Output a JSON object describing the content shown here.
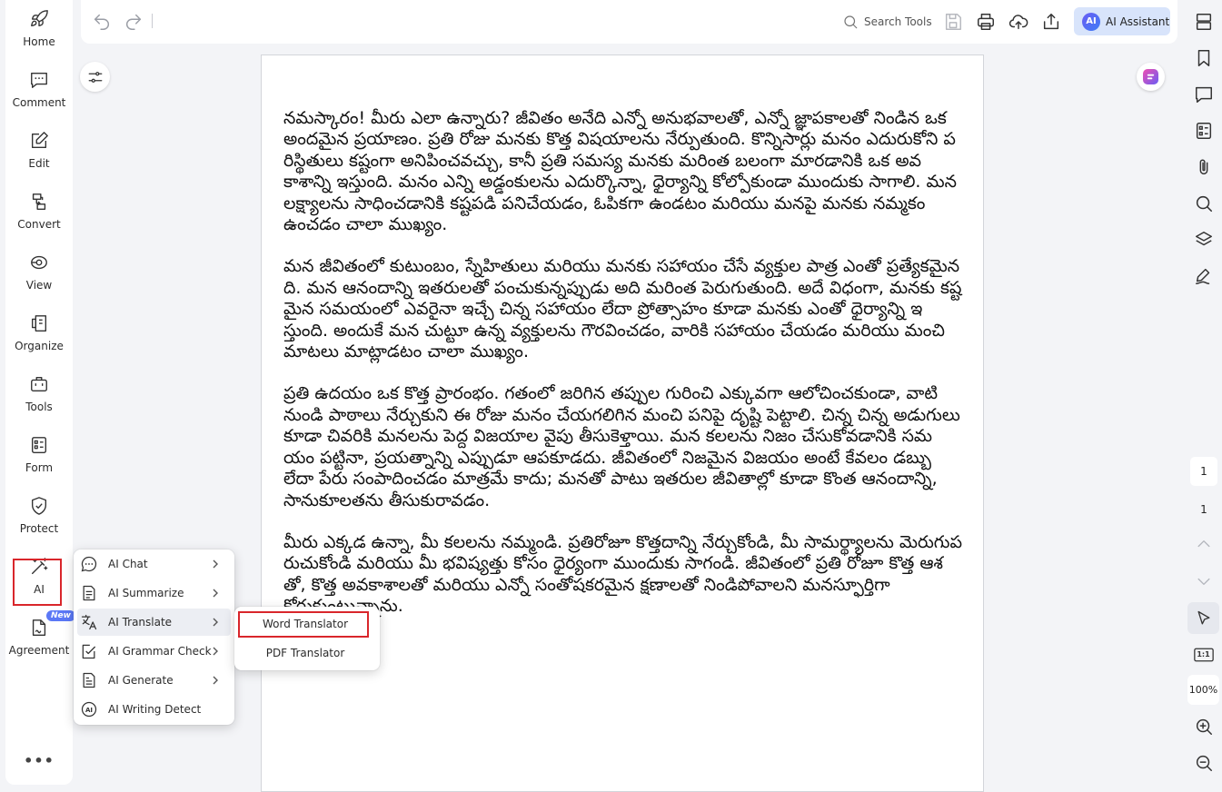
{
  "sidebar": {
    "items": [
      {
        "label": "Home",
        "icon": "rocket-icon"
      },
      {
        "label": "Comment",
        "icon": "comment-icon"
      },
      {
        "label": "Edit",
        "icon": "edit-icon"
      },
      {
        "label": "Convert",
        "icon": "convert-icon"
      },
      {
        "label": "View",
        "icon": "view-icon"
      },
      {
        "label": "Organize",
        "icon": "organize-icon"
      },
      {
        "label": "Tools",
        "icon": "toolbox-icon"
      },
      {
        "label": "Form",
        "icon": "form-icon"
      },
      {
        "label": "Protect",
        "icon": "shield-icon"
      },
      {
        "label": "AI",
        "icon": "magic-wand-icon"
      },
      {
        "label": "Agreement",
        "icon": "agreement-icon"
      }
    ],
    "new_badge": "New",
    "more": "•••"
  },
  "toolbar": {
    "search_label": "Search Tools",
    "ai_badge": "AI",
    "ai_assistant_label": "AI Assistant"
  },
  "document": {
    "paragraphs": [
      "నమస్కారం! మీరు ఎలా ఉన్నారు? జీవితం అనేది ఎన్నో అనుభవాలతో, ఎన్నో జ్ఞాపకాలతో నిండిన ఒక అందమైన ప్రయాణం. ప్రతి రోజు మనకు కొత్త విషయాలను నేర్పుతుంది. కొన్నిసార్లు మనం ఎదురుకోని పరిస్థితులు కష్టంగా అనిపించవచ్చు, కానీ ప్రతి సమస్య మనకు మరింత బలంగా మారడానికి ఒక అవకాశాన్ని ఇస్తుంది. మనం ఎన్ని అడ్డంకులను ఎదుర్కొన్నా, ధైర్యాన్ని కోల్పోకుండా ముందుకు సాగాలి. మన లక్ష్యాలను సాధించడానికి కష్టపడి పనిచేయడం, ఓపికగా ఉండటం మరియు మనపై మనకు నమ్మకం ఉంచడం చాలా ముఖ్యం.",
      "మన జీవితంలో కుటుంబం, స్నేహితులు మరియు మనకు సహాయం చేసే వ్యక్తుల పాత్ర ఎంతో ప్రత్యేకమైనది. మన ఆనందాన్ని ఇతరులతో పంచుకున్నప్పుడు అది మరింత పెరుగుతుంది. అదే విధంగా, మనకు కష్టమైన సమయంలో ఎవరైనా ఇచ్చే చిన్న సహాయం లేదా ప్రోత్సాహం కూడా మనకు ఎంతో ధైర్యాన్ని ఇస్తుంది. అందుకే మన చుట్టూ ఉన్న వ్యక్తులను గౌరవించడం, వారికి సహాయం చేయడం మరియు మంచి మాటలు మాట్లాడటం చాలా ముఖ్యం.",
      "ప్రతి ఉదయం ఒక కొత్త ప్రారంభం. గతంలో జరిగిన తప్పుల గురించి ఎక్కువగా ఆలోచించకుండా, వాటి నుండి పాఠాలు నేర్చుకుని ఈ రోజు మనం చేయగలిగిన మంచి పనిపై దృష్టి పెట్టాలి. చిన్న చిన్న అడుగులు కూడా చివరికి మనలను పెద్ద విజయాల వైపు తీసుకెళ్తాయి. మన కలలను నిజం చేసుకోవడానికి సమయం పట్టినా, ప్రయత్నాన్ని ఎప్పుడూ ఆపకూడదు. జీవితంలో నిజమైన విజయం అంటే కేవలం డబ్బు లేదా పేరు సంపాదించడం మాత్రమే కాదు; మనతో పాటు ఇతరుల జీవితాల్లో కూడా కొంత ఆనందాన్ని, సానుకూలతను తీసుకురావడం.",
      "మీరు ఎక్కడ ఉన్నా, మీ కలలను నమ్మండి. ప్రతిరోజూ కొత్తదాన్ని నేర్చుకోండి, మీ సామర్థ్యాలను మెరుగుపరుచుకోండి మరియు మీ భవిష్యత్తు కోసం ధైర్యంగా ముందుకు సాగండి. జీవితంలో ప్రతి రోజూ కొత్త ఆశతో, కొత్త అవకాశాలతో మరియు ఎన్నో సంతోషకరమైన క్షణాలతో నిండిపోవాలని మనస్ఫూర్తిగా కోరుకుంటున్నాను."
    ]
  },
  "right_panel": {
    "page_current": "1",
    "page_total": "1",
    "zoom": "100%",
    "actual_size": "1:1"
  },
  "ai_menu": {
    "items": [
      {
        "label": "AI Chat",
        "icon": "ai-chat-icon",
        "submenu": true
      },
      {
        "label": "AI Summarize",
        "icon": "summarize-icon",
        "submenu": true
      },
      {
        "label": "AI Translate",
        "icon": "translate-icon",
        "submenu": true
      },
      {
        "label": "AI Grammar Check",
        "icon": "grammar-check-icon",
        "submenu": true
      },
      {
        "label": "AI Generate",
        "icon": "generate-icon",
        "submenu": true
      },
      {
        "label": "AI Writing Detect",
        "icon": "ai-detect-icon",
        "submenu": false
      }
    ]
  },
  "translate_submenu": {
    "items": [
      {
        "label": "Word Translator"
      },
      {
        "label": "PDF Translator"
      }
    ]
  },
  "colors": {
    "highlight_border": "#d9262b",
    "ai_button_bg": "#d8e4fb",
    "accent": "#5b78f6"
  }
}
